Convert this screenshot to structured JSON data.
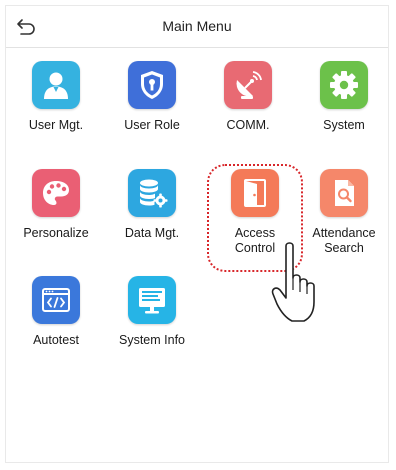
{
  "header": {
    "title": "Main Menu",
    "back_icon": "back-arrow-icon"
  },
  "colors": {
    "user_mgt": "#35b2e0",
    "user_role": "#3f6fd9",
    "comm": "#e86a73",
    "system": "#6cc14a",
    "personalize": "#ea5f74",
    "data_mgt": "#2da7e0",
    "access_control": "#f47a58",
    "attendance_search": "#f5876a",
    "autotest": "#3b78db",
    "system_info": "#26b4e6",
    "highlight": "#d8262a"
  },
  "menu": [
    {
      "id": "user-mgt",
      "label": "User Mgt.",
      "icon": "user-icon"
    },
    {
      "id": "user-role",
      "label": "User Role",
      "icon": "shield-icon"
    },
    {
      "id": "comm",
      "label": "COMM.",
      "icon": "satellite-dish-icon"
    },
    {
      "id": "system",
      "label": "System",
      "icon": "gear-icon"
    },
    {
      "id": "personalize",
      "label": "Personalize",
      "icon": "palette-icon"
    },
    {
      "id": "data-mgt",
      "label": "Data Mgt.",
      "icon": "database-icon"
    },
    {
      "id": "access-control",
      "label": "Access\nControl",
      "icon": "door-icon"
    },
    {
      "id": "attendance-search",
      "label": "Attendance\nSearch",
      "icon": "document-search-icon"
    },
    {
      "id": "autotest",
      "label": "Autotest",
      "icon": "code-icon"
    },
    {
      "id": "system-info",
      "label": "System Info",
      "icon": "monitor-icon"
    }
  ],
  "annotation": {
    "highlighted_item": "access-control",
    "pointer": "pointing-hand-icon"
  }
}
